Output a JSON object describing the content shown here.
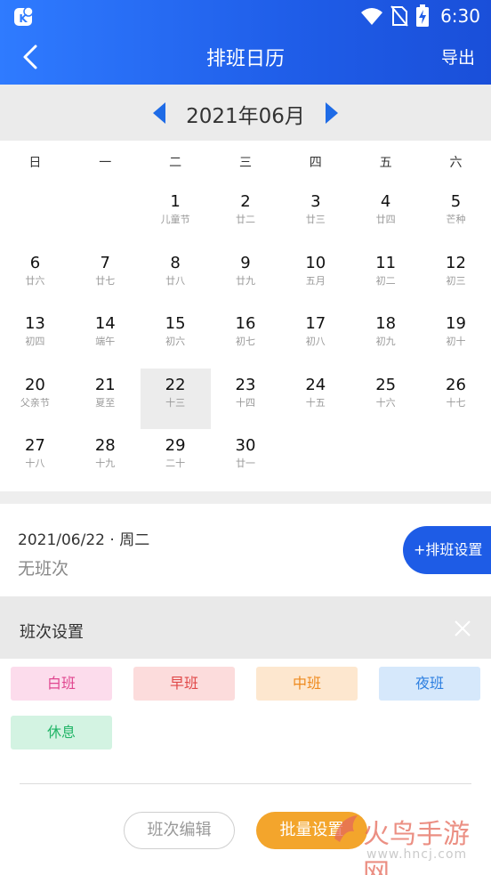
{
  "status": {
    "time": "6:30"
  },
  "header": {
    "title": "排班日历",
    "export_label": "导出"
  },
  "calendar": {
    "month_label": "2021年06月",
    "weekdays": [
      "日",
      "一",
      "二",
      "三",
      "四",
      "五",
      "六"
    ],
    "selected_day": "22",
    "weeks": [
      [
        null,
        null,
        {
          "day": "1",
          "lunar": "儿童节"
        },
        {
          "day": "2",
          "lunar": "廿二"
        },
        {
          "day": "3",
          "lunar": "廿三"
        },
        {
          "day": "4",
          "lunar": "廿四"
        },
        {
          "day": "5",
          "lunar": "芒种"
        }
      ],
      [
        {
          "day": "6",
          "lunar": "廿六"
        },
        {
          "day": "7",
          "lunar": "廿七"
        },
        {
          "day": "8",
          "lunar": "廿八"
        },
        {
          "day": "9",
          "lunar": "廿九"
        },
        {
          "day": "10",
          "lunar": "五月"
        },
        {
          "day": "11",
          "lunar": "初二"
        },
        {
          "day": "12",
          "lunar": "初三"
        }
      ],
      [
        {
          "day": "13",
          "lunar": "初四"
        },
        {
          "day": "14",
          "lunar": "端午"
        },
        {
          "day": "15",
          "lunar": "初六"
        },
        {
          "day": "16",
          "lunar": "初七"
        },
        {
          "day": "17",
          "lunar": "初八"
        },
        {
          "day": "18",
          "lunar": "初九"
        },
        {
          "day": "19",
          "lunar": "初十"
        }
      ],
      [
        {
          "day": "20",
          "lunar": "父亲节"
        },
        {
          "day": "21",
          "lunar": "夏至"
        },
        {
          "day": "22",
          "lunar": "十三"
        },
        {
          "day": "23",
          "lunar": "十四"
        },
        {
          "day": "24",
          "lunar": "十五"
        },
        {
          "day": "25",
          "lunar": "十六"
        },
        {
          "day": "26",
          "lunar": "十七"
        }
      ],
      [
        {
          "day": "27",
          "lunar": "十八"
        },
        {
          "day": "28",
          "lunar": "十九"
        },
        {
          "day": "29",
          "lunar": "二十"
        },
        {
          "day": "30",
          "lunar": "廿一"
        },
        null,
        null,
        null
      ]
    ]
  },
  "selection": {
    "date_label": "2021/06/22 · 周二",
    "status": "无班次",
    "add_label": "+排班设置"
  },
  "shift_panel": {
    "title": "班次设置",
    "shifts": [
      {
        "label": "白班",
        "bg": "#fcdcec",
        "fg": "#e0468f"
      },
      {
        "label": "早班",
        "bg": "#fcdcdc",
        "fg": "#e04848"
      },
      {
        "label": "中班",
        "bg": "#fde7cf",
        "fg": "#ee8a1e"
      },
      {
        "label": "夜班",
        "bg": "#d6e8fb",
        "fg": "#2d7fe0"
      },
      {
        "label": "休息",
        "bg": "#d3f3e2",
        "fg": "#21b567"
      }
    ],
    "edit_label": "班次编辑",
    "batch_label": "批量设置"
  },
  "watermark": {
    "text": "火鸟手游网",
    "url": "www.hncj.com"
  },
  "colors": {
    "primary": "#1e5ce6",
    "accent": "#f3a52c",
    "selected_bg": "#ececec"
  }
}
